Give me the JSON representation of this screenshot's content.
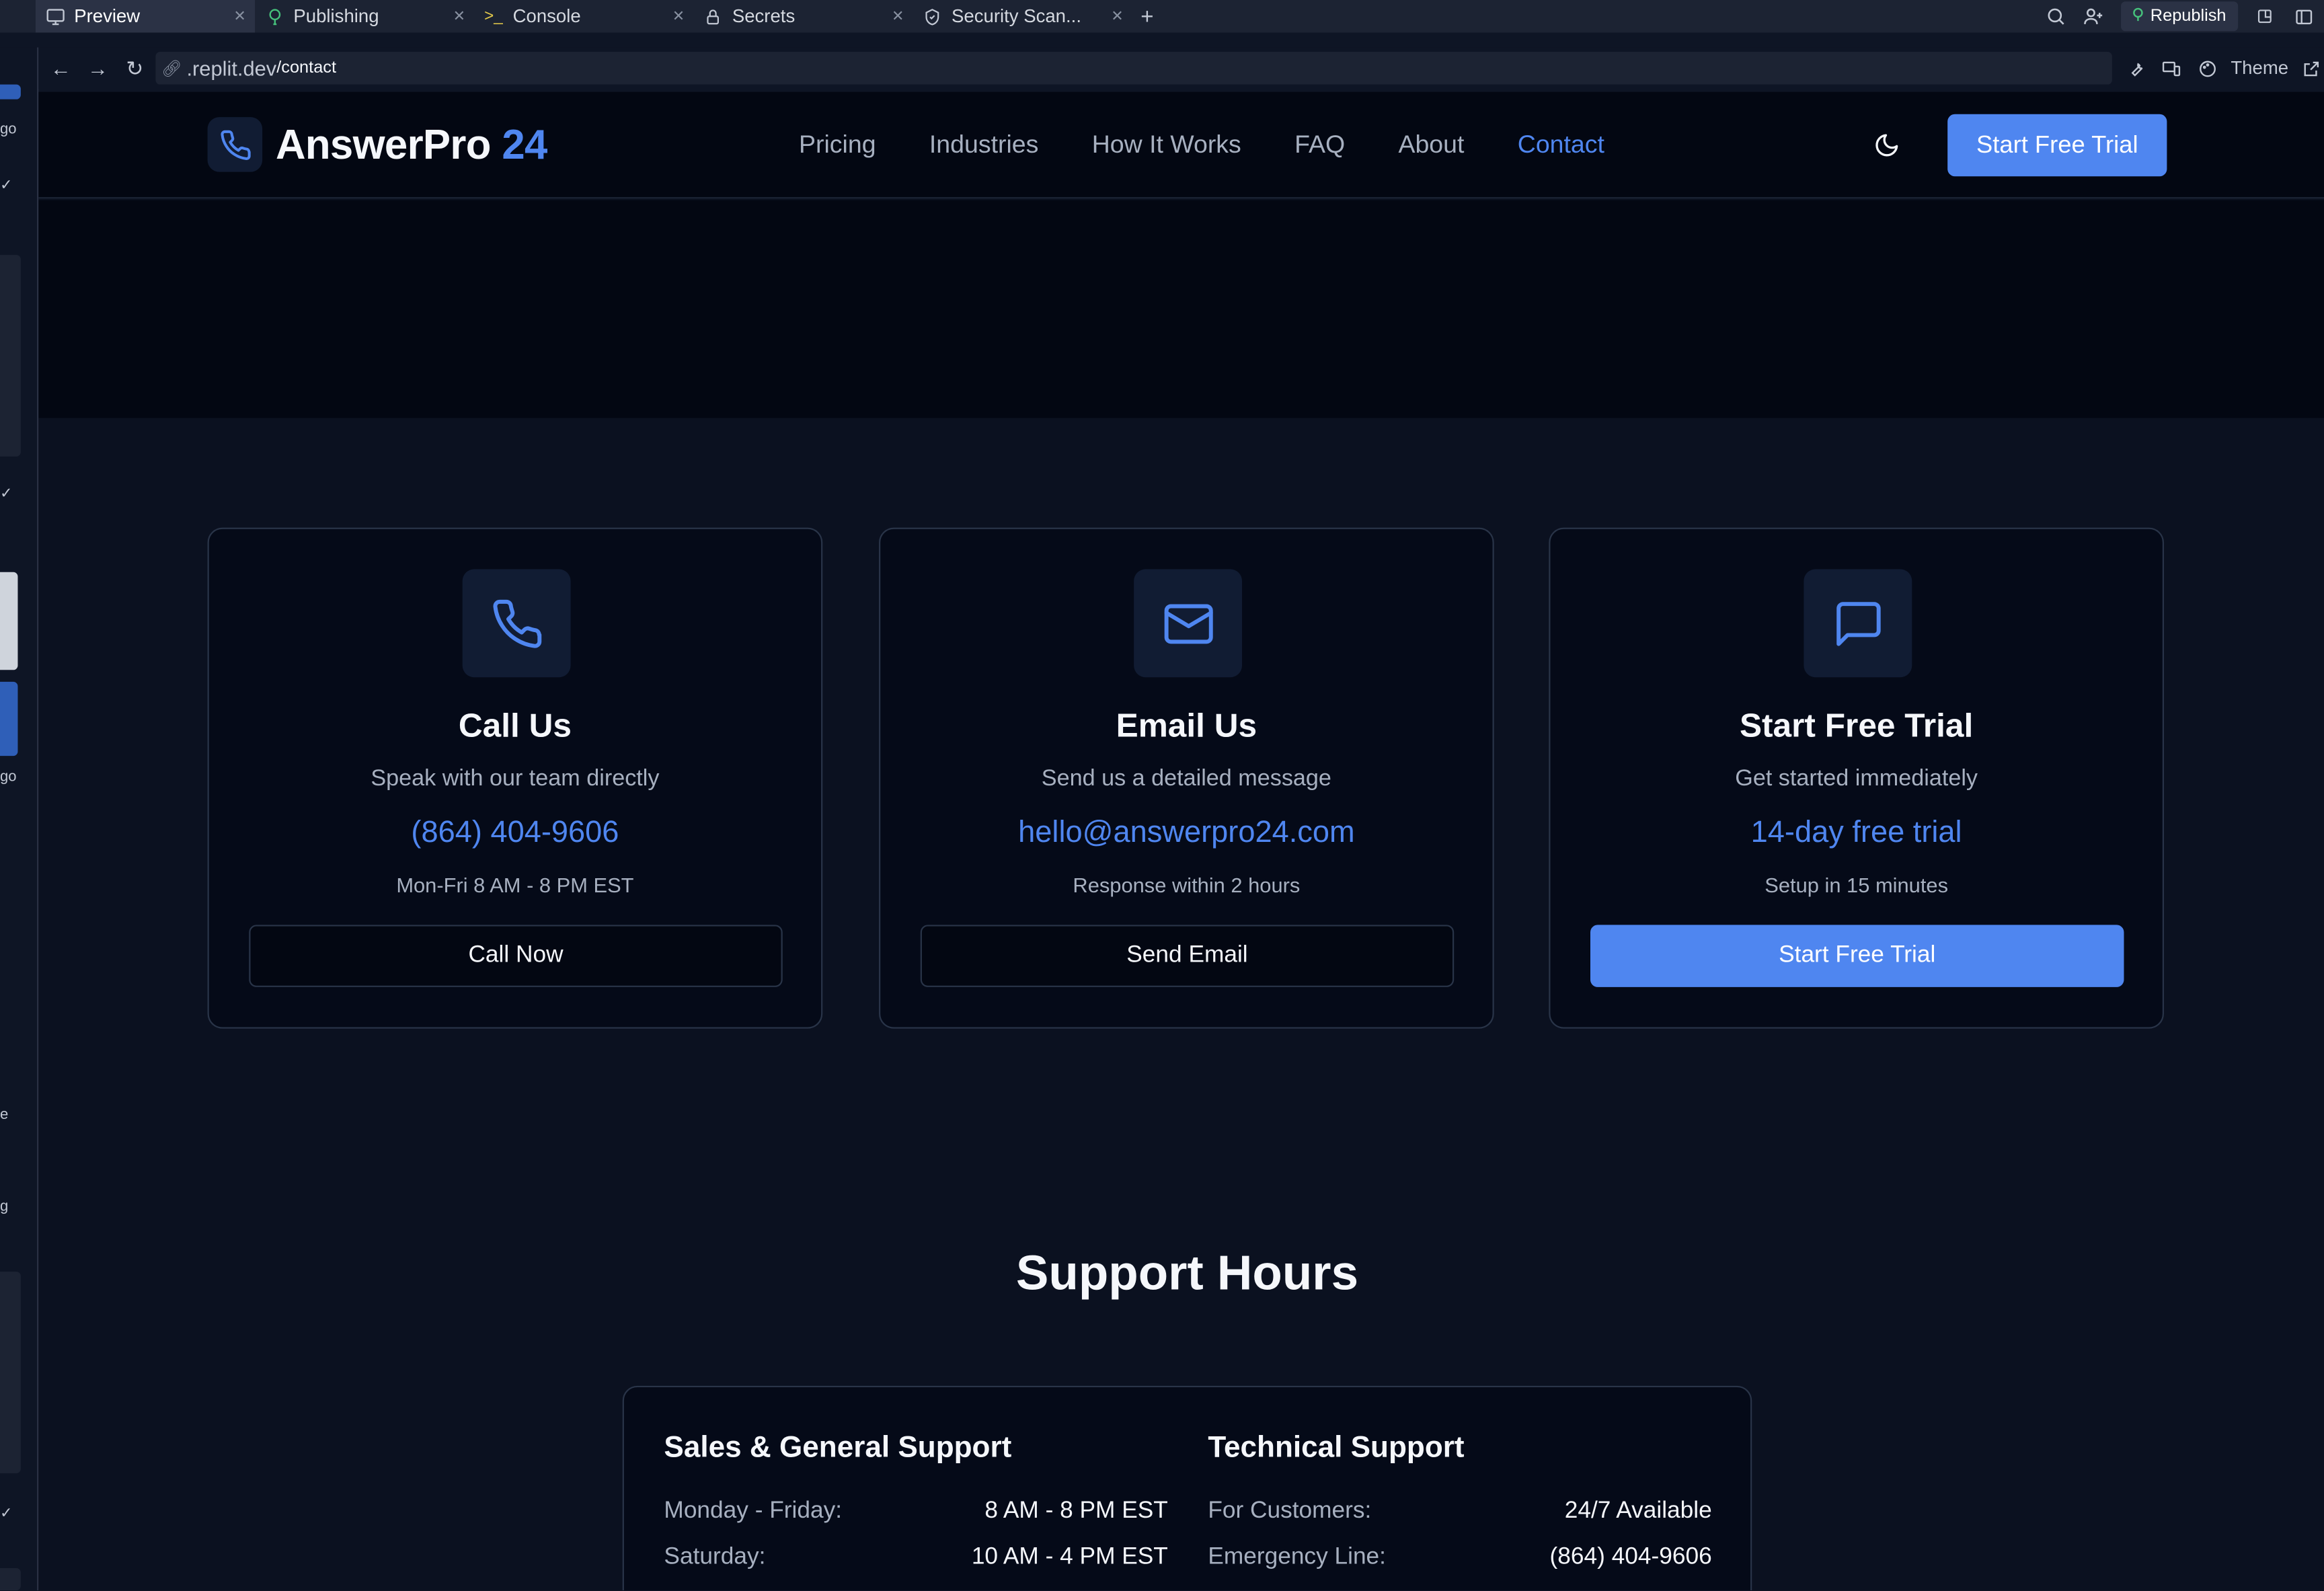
{
  "browser": {
    "tabs": [
      {
        "label": "Preview",
        "icon": "monitor-icon",
        "active": true
      },
      {
        "label": "Publishing",
        "icon": "balloon-icon",
        "active": false
      },
      {
        "label": "Console",
        "icon": "terminal-icon",
        "active": false
      },
      {
        "label": "Secrets",
        "icon": "lock-icon",
        "active": false
      },
      {
        "label": "Security Scan...",
        "icon": "shield-icon",
        "active": false
      }
    ],
    "republish_label": "Republish",
    "url_domain": ".replit.dev",
    "url_path": "/contact",
    "theme_label": "Theme"
  },
  "leftrail": {
    "labels": [
      "go",
      "go",
      "e",
      "g"
    ]
  },
  "site": {
    "logo_name": "AnswerPro",
    "logo_number": "24",
    "nav": [
      "Pricing",
      "Industries",
      "How It Works",
      "FAQ",
      "About",
      "Contact"
    ],
    "active_nav": "Contact",
    "cta_label": "Start Free Trial"
  },
  "cards": [
    {
      "icon": "phone-icon",
      "title": "Call Us",
      "subtitle": "Speak with our team directly",
      "highlight": "(864) 404-9606",
      "note": "Mon-Fri 8 AM - 8 PM EST",
      "button": "Call Now",
      "primary": false
    },
    {
      "icon": "mail-icon",
      "title": "Email Us",
      "subtitle": "Send us a detailed message",
      "highlight": "hello@answerpro24.com",
      "note": "Response within 2 hours",
      "button": "Send Email",
      "primary": false
    },
    {
      "icon": "message-square-icon",
      "title": "Start Free Trial",
      "subtitle": "Get started immediately",
      "highlight": "14-day free trial",
      "note": "Setup in 15 minutes",
      "button": "Start Free Trial",
      "primary": true
    }
  ],
  "support": {
    "title": "Support Hours",
    "sales": {
      "heading": "Sales & General Support",
      "rows": [
        {
          "k": "Monday - Friday:",
          "v": "8 AM - 8 PM EST"
        },
        {
          "k": "Saturday:",
          "v": "10 AM - 4 PM EST"
        }
      ]
    },
    "tech": {
      "heading": "Technical Support",
      "rows": [
        {
          "k": "For Customers:",
          "v": "24/7 Available"
        },
        {
          "k": "Emergency Line:",
          "v": "(864) 404-9606"
        }
      ]
    }
  },
  "colors": {
    "accent": "#4f86f0",
    "page_bg": "#0b1120",
    "header_bg": "#030712",
    "card_border": "#293448"
  }
}
